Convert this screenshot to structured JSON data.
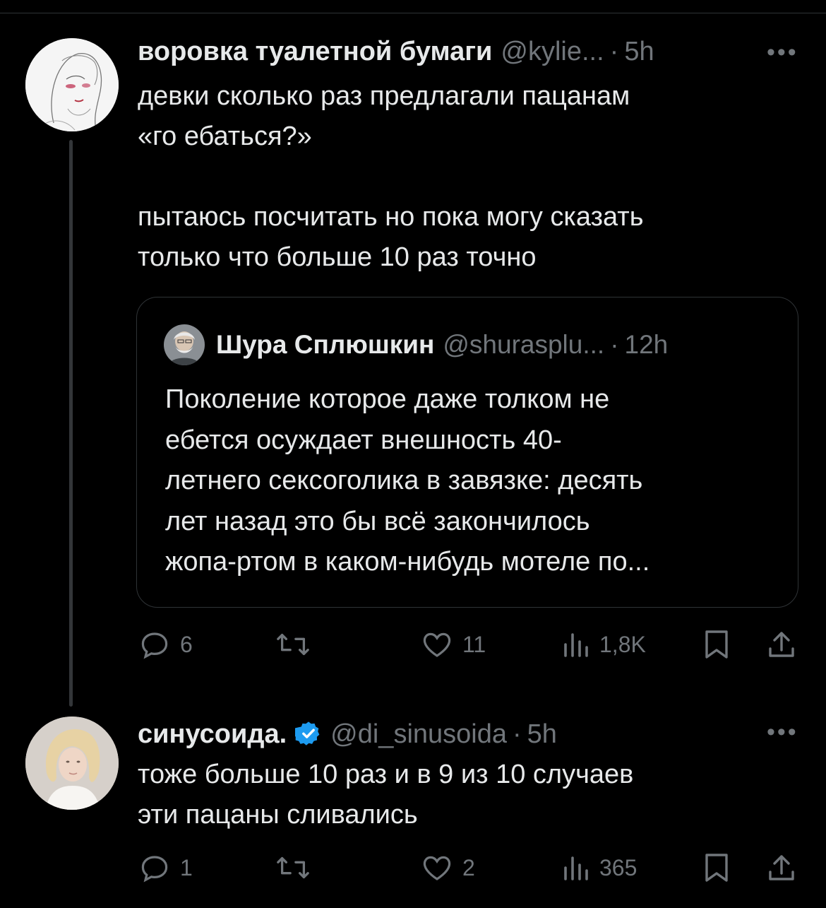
{
  "tweets": [
    {
      "display_name": "воровка туалетной бумаги",
      "handle": "@kylie...",
      "time": "5h",
      "text": "девки сколько раз предлагали пацанам\n«го ебаться?»\n\nпытаюсь посчитать но пока могу сказать\nтолько что больше 10 раз точно",
      "quote": {
        "display_name": "Шура Сплюшкин",
        "handle": "@shurasplu...",
        "time": "12h",
        "text": "Поколение которое даже толком не\nебется осуждает внешность 40-\nлетнего сексоголика в завязке: десять\nлет назад это бы всё закончилось\nжопа-ртом в каком-нибудь мотеле по..."
      },
      "stats": {
        "replies": "6",
        "reposts": "",
        "likes": "11",
        "views": "1,8K"
      }
    },
    {
      "display_name": "синусоида.",
      "verified": true,
      "handle": "@di_sinusoida",
      "time": "5h",
      "text": "тоже больше 10 раз и в 9 из 10 случаев\nэти пацаны сливались",
      "stats": {
        "replies": "1",
        "reposts": "",
        "likes": "2",
        "views": "365"
      }
    }
  ],
  "separator": "·",
  "more_label": "•••",
  "colors": {
    "background": "#000000",
    "text": "#e7e9ea",
    "muted": "#71767b",
    "verified": "#1d9bf0",
    "border": "#2f3336"
  },
  "icons": [
    "reply-icon",
    "repost-icon",
    "like-icon",
    "views-icon",
    "bookmark-icon",
    "share-icon",
    "verified-badge-icon"
  ]
}
